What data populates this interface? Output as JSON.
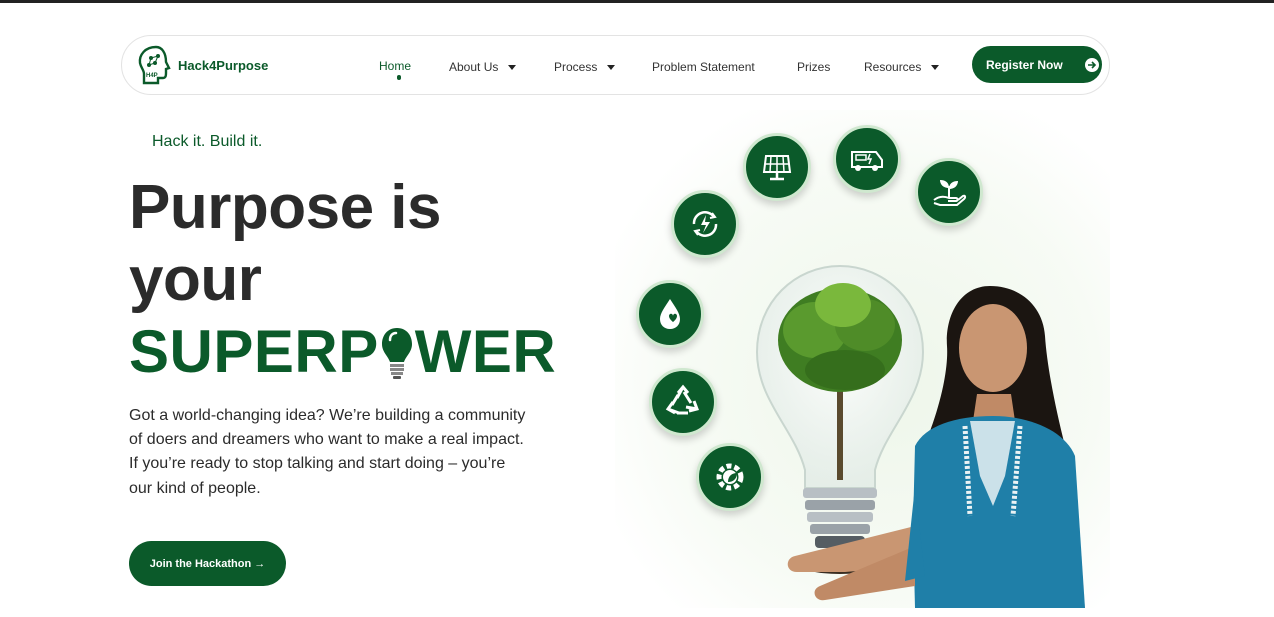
{
  "nav": {
    "logo_text": "Hack4Purpose",
    "logo_badge": "H4P",
    "items": [
      {
        "label": "Home",
        "active": true,
        "dropdown": false
      },
      {
        "label": "About Us",
        "active": false,
        "dropdown": true
      },
      {
        "label": "Process",
        "active": false,
        "dropdown": true
      },
      {
        "label": "Problem Statement",
        "active": false,
        "dropdown": false
      },
      {
        "label": "Prizes",
        "active": false,
        "dropdown": false
      },
      {
        "label": "Resources",
        "active": false,
        "dropdown": true
      }
    ],
    "register_label": "Register Now"
  },
  "hero": {
    "tagline": "Hack it. Build it.",
    "headline_line1": "Purpose is",
    "headline_line2": "your",
    "superpower_part1": "SUPERP",
    "superpower_part2": "WER",
    "description": "Got a world-changing idea? We’re building a community of doers and dreamers who want to make a real impact. If you’re ready to stop talking and start doing – you’re our kind of people.",
    "cta_label": "Join the Hackathon →"
  },
  "illustration": {
    "icons": [
      "renewable-energy-icon",
      "solar-panel-icon",
      "electric-vehicle-icon",
      "plant-in-hand-icon",
      "water-drop-heart-icon",
      "recycle-icon",
      "eco-gear-icon"
    ]
  },
  "colors": {
    "brand_green": "#0b5a2a",
    "text_dark": "#2b2b2b"
  }
}
